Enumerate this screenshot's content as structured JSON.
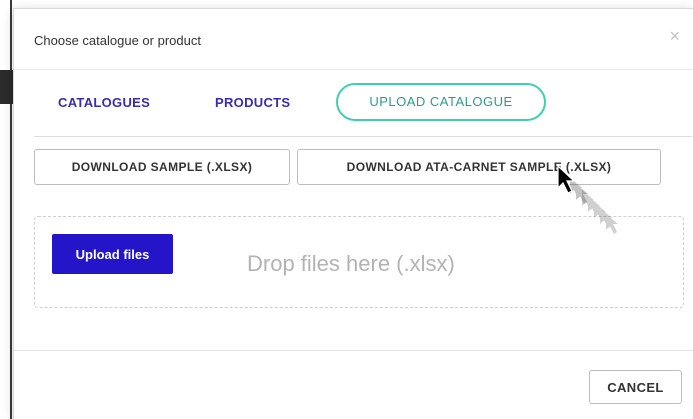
{
  "modal": {
    "title": "Choose catalogue or product",
    "close_glyph": "×"
  },
  "tabs": [
    {
      "label": "CATALOGUES",
      "active": false
    },
    {
      "label": "PRODUCTS",
      "active": false
    },
    {
      "label": "UPLOAD CATALOGUE",
      "active": true
    }
  ],
  "downloads": {
    "sample_label": "DOWNLOAD SAMPLE (.XLSX)",
    "ata_label": "DOWNLOAD ATA-CARNET SAMPLE (.XLSX)"
  },
  "dropzone": {
    "button_label": "Upload files",
    "hint": "Drop files here (.xlsx)"
  },
  "footer": {
    "cancel_label": "CANCEL"
  },
  "colors": {
    "tab_text": "#3a2bb0",
    "active_tab_border": "#3ecfb0",
    "upload_button": "#2416c8"
  },
  "icons": {
    "close": "close-icon",
    "cursor": "mouse-pointer-icon"
  }
}
